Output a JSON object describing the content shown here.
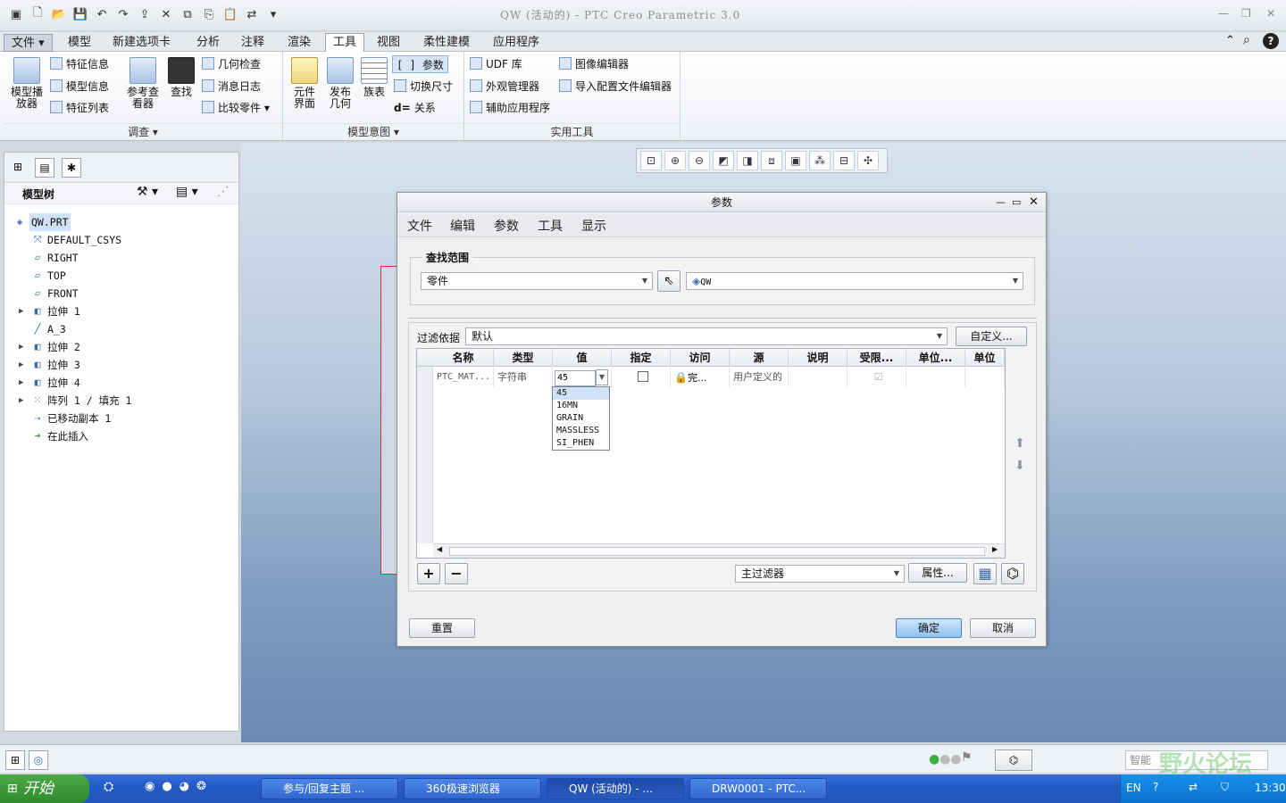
{
  "app": {
    "title": "QW (活动的) - PTC Creo Parametric 3.0"
  },
  "menu_tabs": [
    "文件",
    "模型",
    "新建选项卡",
    "分析",
    "注释",
    "渲染",
    "工具",
    "视图",
    "柔性建模",
    "应用程序"
  ],
  "ribbon": {
    "investigate": {
      "caption": "调查",
      "model_player": "模型播\n放器",
      "feature_info": "特征信息",
      "model_info": "模型信息",
      "feature_list": "特征列表",
      "ref_viewer": "参考查\n看器",
      "find": "查找",
      "geom_check": "几何检查",
      "message_log": "消息日志",
      "compare_parts": "比较零件"
    },
    "model_intent": {
      "caption": "模型意图",
      "component_interface": "元件\n界面",
      "publish_geom": "发布\n几何",
      "family_table": "族表",
      "parameters": "参数",
      "switch_dims": "切换尺寸",
      "relations": "关系"
    },
    "utilities": {
      "caption": "实用工具",
      "udf_lib": "UDF 库",
      "appearance_mgr": "外观管理器",
      "aux_apps": "辅助应用程序",
      "image_editor": "图像编辑器",
      "config_editor": "导入配置文件编辑器"
    }
  },
  "model_tree": {
    "title": "模型树",
    "items": [
      {
        "label": "QW.PRT",
        "icon": "part-icon"
      },
      {
        "label": "DEFAULT_CSYS",
        "icon": "csys-icon"
      },
      {
        "label": "RIGHT",
        "icon": "datum-plane-icon"
      },
      {
        "label": "TOP",
        "icon": "datum-plane-icon"
      },
      {
        "label": "FRONT",
        "icon": "datum-plane-icon"
      },
      {
        "label": "拉伸 1",
        "icon": "extrude-icon"
      },
      {
        "label": "A_3",
        "icon": "axis-icon"
      },
      {
        "label": "拉伸 2",
        "icon": "extrude-icon"
      },
      {
        "label": "拉伸 3",
        "icon": "extrude-icon"
      },
      {
        "label": "拉伸 4",
        "icon": "extrude-icon"
      },
      {
        "label": "阵列 1 / 填充 1",
        "icon": "pattern-icon"
      },
      {
        "label": "已移动副本 1",
        "icon": "moved-copy-icon"
      },
      {
        "label": "在此插入",
        "icon": "insert-here-icon"
      }
    ]
  },
  "dialog": {
    "title": "参数",
    "menu": [
      "文件",
      "编辑",
      "参数",
      "工具",
      "显示"
    ],
    "scope_label": "查找范围",
    "scope_type": "零件",
    "scope_object": "QW",
    "filter_label": "过滤依据",
    "filter_value": "默认",
    "customize": "自定义...",
    "columns": [
      "名称",
      "类型",
      "值",
      "指定",
      "访问",
      "源",
      "说明",
      "受限...",
      "单位...",
      "单位"
    ],
    "row": {
      "name": "PTC_MAT...",
      "type": "字符串",
      "value": "45",
      "access": "完...",
      "source": "用户定义的"
    },
    "value_options": [
      "45",
      "16MN",
      "GRAIN",
      "MASSLESS",
      "SI_PHEN"
    ],
    "main_filter": "主过滤器",
    "properties": "属性...",
    "reset": "重置",
    "ok": "确定",
    "cancel": "取消"
  },
  "status": {
    "smart": "智能"
  },
  "taskbar": {
    "start": "开始",
    "tasks": [
      "参与/回复主题 ...",
      "360极速浏览器",
      "QW (活动的) - ...",
      "DRW0001 - PTC..."
    ],
    "lang": "EN",
    "clock": "13:30",
    "watermark": "野火论坛"
  }
}
